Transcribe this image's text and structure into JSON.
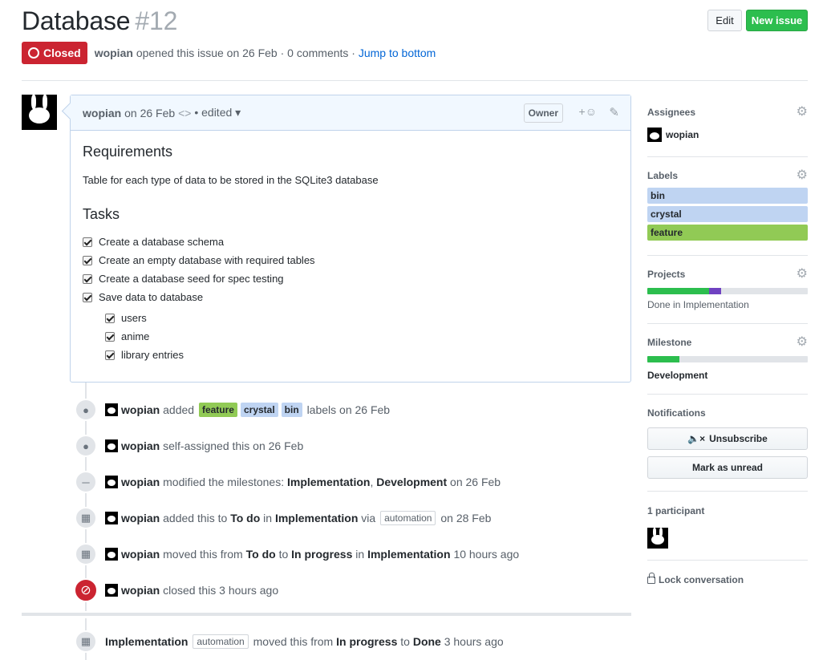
{
  "header": {
    "title": "Database",
    "number": "#12",
    "edit_label": "Edit",
    "new_issue_label": "New issue"
  },
  "meta": {
    "state": "Closed",
    "author": "wopian",
    "text": "opened this issue on 26 Feb · 0 comments ·",
    "jump": "Jump to bottom"
  },
  "comment": {
    "author": "wopian",
    "date": "on 26 Feb",
    "edited": "• edited ▾",
    "owner_badge": "Owner",
    "react": "+☺",
    "edit_icon": "✎",
    "heading1": "Requirements",
    "text": "Table for each type of data to be stored in the SQLite3 database",
    "heading2": "Tasks",
    "tasks": [
      "Create a database schema",
      "Create an empty database with required tables",
      "Create a database seed for spec testing",
      "Save data to database"
    ],
    "subtasks": [
      "users",
      "anime",
      "library entries"
    ]
  },
  "timeline": {
    "e1": {
      "user": "wopian",
      "pre": "added",
      "labels": [
        "feature",
        "crystal",
        "bin"
      ],
      "post": "labels on 26 Feb"
    },
    "e2": {
      "user": "wopian",
      "text": "self-assigned this on 26 Feb"
    },
    "e3": {
      "user": "wopian",
      "pre": "modified the milestones:",
      "m1": "Implementation",
      "sep": ",",
      "m2": "Development",
      "post": "on 26 Feb"
    },
    "e4": {
      "user": "wopian",
      "pre": "added this to",
      "col": "To do",
      "in": "in",
      "proj": "Implementation",
      "via": "via",
      "tag": "automation",
      "post": "on 28 Feb"
    },
    "e5": {
      "user": "wopian",
      "pre": "moved this from",
      "from": "To do",
      "to_word": "to",
      "to": "In progress",
      "in": "in",
      "proj": "Implementation",
      "post": "10 hours ago"
    },
    "e6": {
      "user": "wopian",
      "text": "closed this 3 hours ago"
    },
    "e7": {
      "proj": "Implementation",
      "tag": "automation",
      "pre": "moved this from",
      "from": "In progress",
      "to_word": "to",
      "to": "Done",
      "post": "3 hours ago"
    }
  },
  "sidebar": {
    "assignees": {
      "title": "Assignees",
      "user": "wopian"
    },
    "labels": {
      "title": "Labels",
      "items": [
        {
          "name": "bin",
          "color": "#bfd4f2"
        },
        {
          "name": "crystal",
          "color": "#bfd4f2"
        },
        {
          "name": "feature",
          "color": "#91ca55"
        }
      ]
    },
    "projects": {
      "title": "Projects",
      "status": "Done in Implementation",
      "done_fraction": 0.385,
      "inprogress_fraction": 0.075
    },
    "milestone": {
      "title": "Milestone",
      "name": "Development",
      "progress": 0.2
    },
    "notifications": {
      "title": "Notifications",
      "unsubscribe": "Unsubscribe",
      "mark_unread": "Mark as unread"
    },
    "participants": {
      "title": "1 participant"
    },
    "lock": "Lock conversation"
  },
  "colors": {
    "closed": "#cb2431",
    "new_issue": "#2cbe4e",
    "link": "#0366d6",
    "progress_green": "#2cbe4e",
    "progress_purple": "#6f42c1"
  }
}
